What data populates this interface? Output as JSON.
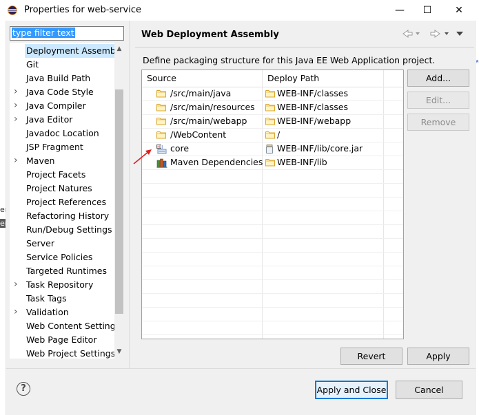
{
  "window": {
    "title": "Properties for web-service",
    "minimize": "—",
    "maximize": "☐",
    "close": "✕"
  },
  "filter": {
    "value": "type filter text"
  },
  "tree": {
    "items": [
      {
        "label": "Deployment Assembly",
        "expandable": false,
        "selected": true
      },
      {
        "label": "Git",
        "expandable": false
      },
      {
        "label": "Java Build Path",
        "expandable": false
      },
      {
        "label": "Java Code Style",
        "expandable": true
      },
      {
        "label": "Java Compiler",
        "expandable": true
      },
      {
        "label": "Java Editor",
        "expandable": true
      },
      {
        "label": "Javadoc Location",
        "expandable": false
      },
      {
        "label": "JSP Fragment",
        "expandable": false
      },
      {
        "label": "Maven",
        "expandable": true
      },
      {
        "label": "Project Facets",
        "expandable": false
      },
      {
        "label": "Project Natures",
        "expandable": false
      },
      {
        "label": "Project References",
        "expandable": false
      },
      {
        "label": "Refactoring History",
        "expandable": false
      },
      {
        "label": "Run/Debug Settings",
        "expandable": false
      },
      {
        "label": "Server",
        "expandable": false
      },
      {
        "label": "Service Policies",
        "expandable": false
      },
      {
        "label": "Targeted Runtimes",
        "expandable": false
      },
      {
        "label": "Task Repository",
        "expandable": true
      },
      {
        "label": "Task Tags",
        "expandable": false
      },
      {
        "label": "Validation",
        "expandable": true
      },
      {
        "label": "Web Content Settings",
        "expandable": false
      },
      {
        "label": "Web Page Editor",
        "expandable": false
      },
      {
        "label": "Web Project Settings",
        "expandable": false
      }
    ]
  },
  "page": {
    "title": "Web Deployment Assembly",
    "description": "Define packaging structure for this Java EE Web Application project."
  },
  "table": {
    "columns": [
      "Source",
      "Deploy Path"
    ],
    "rows": [
      {
        "source": "/src/main/java",
        "source_icon": "folder-icon",
        "deploy": "WEB-INF/classes"
      },
      {
        "source": "/src/main/resources",
        "source_icon": "folder-icon",
        "deploy": "WEB-INF/classes"
      },
      {
        "source": "/src/main/webapp",
        "source_icon": "folder-icon",
        "deploy": "WEB-INF/webapp"
      },
      {
        "source": "/WebContent",
        "source_icon": "folder-icon",
        "deploy": "/"
      },
      {
        "source": "core",
        "source_icon": "maven-project-icon",
        "deploy": "WEB-INF/lib/core.jar",
        "deploy_icon": "jar-icon"
      },
      {
        "source": "Maven Dependencies",
        "source_icon": "library-icon",
        "deploy": "WEB-INF/lib"
      }
    ]
  },
  "buttons": {
    "add": "Add...",
    "edit": "Edit...",
    "remove": "Remove",
    "revert": "Revert",
    "apply": "Apply",
    "apply_close": "Apply and Close",
    "cancel": "Cancel"
  },
  "help": {
    "glyph": "?"
  },
  "background": {
    "left_char_1": "er",
    "left_char_2": "er",
    "right_glyph": "↗"
  },
  "colors": {
    "selection": "#cce8ff",
    "accent": "#0078d7",
    "annotation_arrow": "#e02020"
  }
}
